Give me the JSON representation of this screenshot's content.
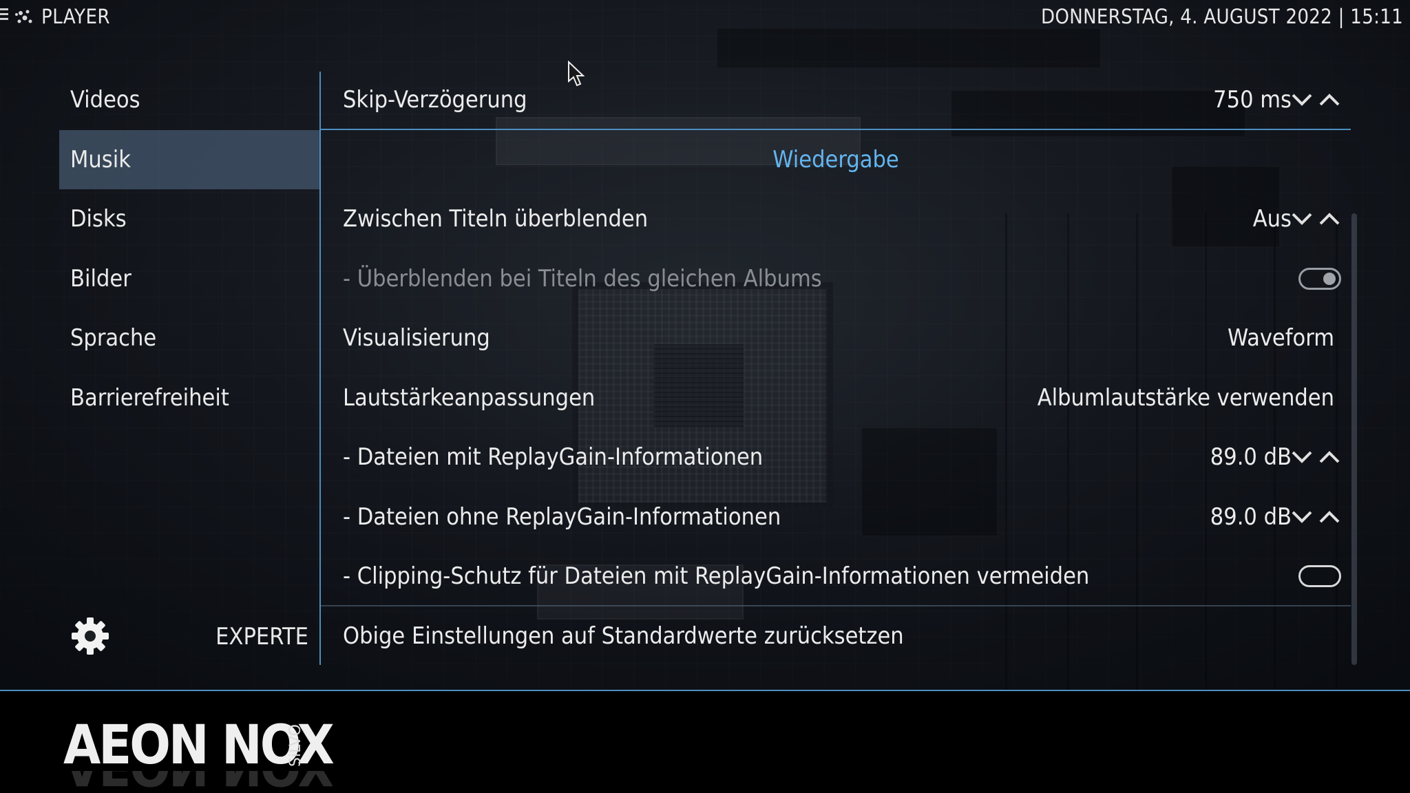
{
  "header": {
    "section_title": "PLAYER",
    "datetime": "DONNERSTAG, 4. AUGUST 2022 | 15:11"
  },
  "left_menu": {
    "items": [
      {
        "label": "Videos",
        "selected": false
      },
      {
        "label": "Musik",
        "selected": true
      },
      {
        "label": "Disks",
        "selected": false
      },
      {
        "label": "Bilder",
        "selected": false
      },
      {
        "label": "Sprache",
        "selected": false
      },
      {
        "label": "Barrierefreiheit",
        "selected": false
      }
    ],
    "settings_level": "EXPERTE"
  },
  "settings": {
    "skip_delay": {
      "label": "Skip-Verzögerung",
      "value": "750 ms"
    },
    "category": "Wiedergabe",
    "crossfade": {
      "label": "Zwischen Titeln überblenden",
      "value": "Aus"
    },
    "crossfade_album": {
      "label": "- Überblenden bei Titeln des gleichen Albums",
      "enabled": true
    },
    "visualization": {
      "label": "Visualisierung",
      "value": "Waveform"
    },
    "volume_adjust": {
      "label": "Lautstärkeanpassungen",
      "value": "Albumlautstärke verwenden"
    },
    "rg_with_info": {
      "label": "- Dateien mit ReplayGain-Informationen",
      "value": "89.0 dB"
    },
    "rg_without_info": {
      "label": "- Dateien ohne ReplayGain-Informationen",
      "value": "89.0 dB"
    },
    "clipping": {
      "label": "- Clipping-Schutz für Dateien mit ReplayGain-Informationen vermeiden",
      "enabled": false
    },
    "reset": {
      "label": "Obige Einstellungen auf Standardwerte zurücksetzen"
    }
  },
  "footer": {
    "logo_text": "AEON NOX",
    "logo_sub": "SiLVO"
  },
  "colors": {
    "accent": "#4d8fc2",
    "category_text": "#63b5ef",
    "selected_bg": "#3e5064"
  },
  "icons": [
    "menu-icon",
    "player-icon",
    "gear-icon",
    "chevron-down-icon",
    "chevron-up-icon",
    "toggle-icon",
    "mouse-cursor-icon"
  ]
}
